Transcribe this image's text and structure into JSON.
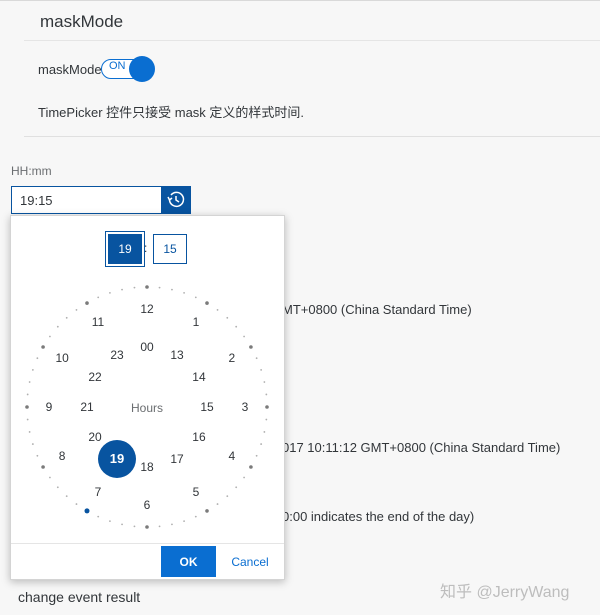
{
  "panel": {
    "title": "maskMode",
    "switch_label": "maskMode:",
    "switch_state": "ON",
    "description": "TimePicker 控件只接受 mask 定义的样式时间."
  },
  "field": {
    "format_label": "HH:mm",
    "value": "19:15",
    "picker_icon": "time-history-icon"
  },
  "picker": {
    "hours": "19",
    "separator": ":",
    "minutes": "15",
    "center_label": "Hours",
    "selected_hour": "19",
    "outer_hours": [
      "12",
      "1",
      "2",
      "3",
      "4",
      "5",
      "6",
      "7",
      "8",
      "9",
      "10",
      "11"
    ],
    "inner_hours": [
      "00",
      "13",
      "14",
      "15",
      "16",
      "17",
      "18",
      "19",
      "20",
      "21",
      "22",
      "23"
    ],
    "ok_label": "OK",
    "cancel_label": "Cancel"
  },
  "background": {
    "line1": "MT+0800 (China Standard Time)",
    "line2": "017 10:11:12 GMT+0800 (China Standard Time)",
    "line3": "0:00 indicates the end of the day)",
    "change_label": "change event result"
  },
  "watermark": "知乎 @JerryWang",
  "colors": {
    "accent": "#0a6ed1",
    "dark_accent": "#0854a0"
  }
}
